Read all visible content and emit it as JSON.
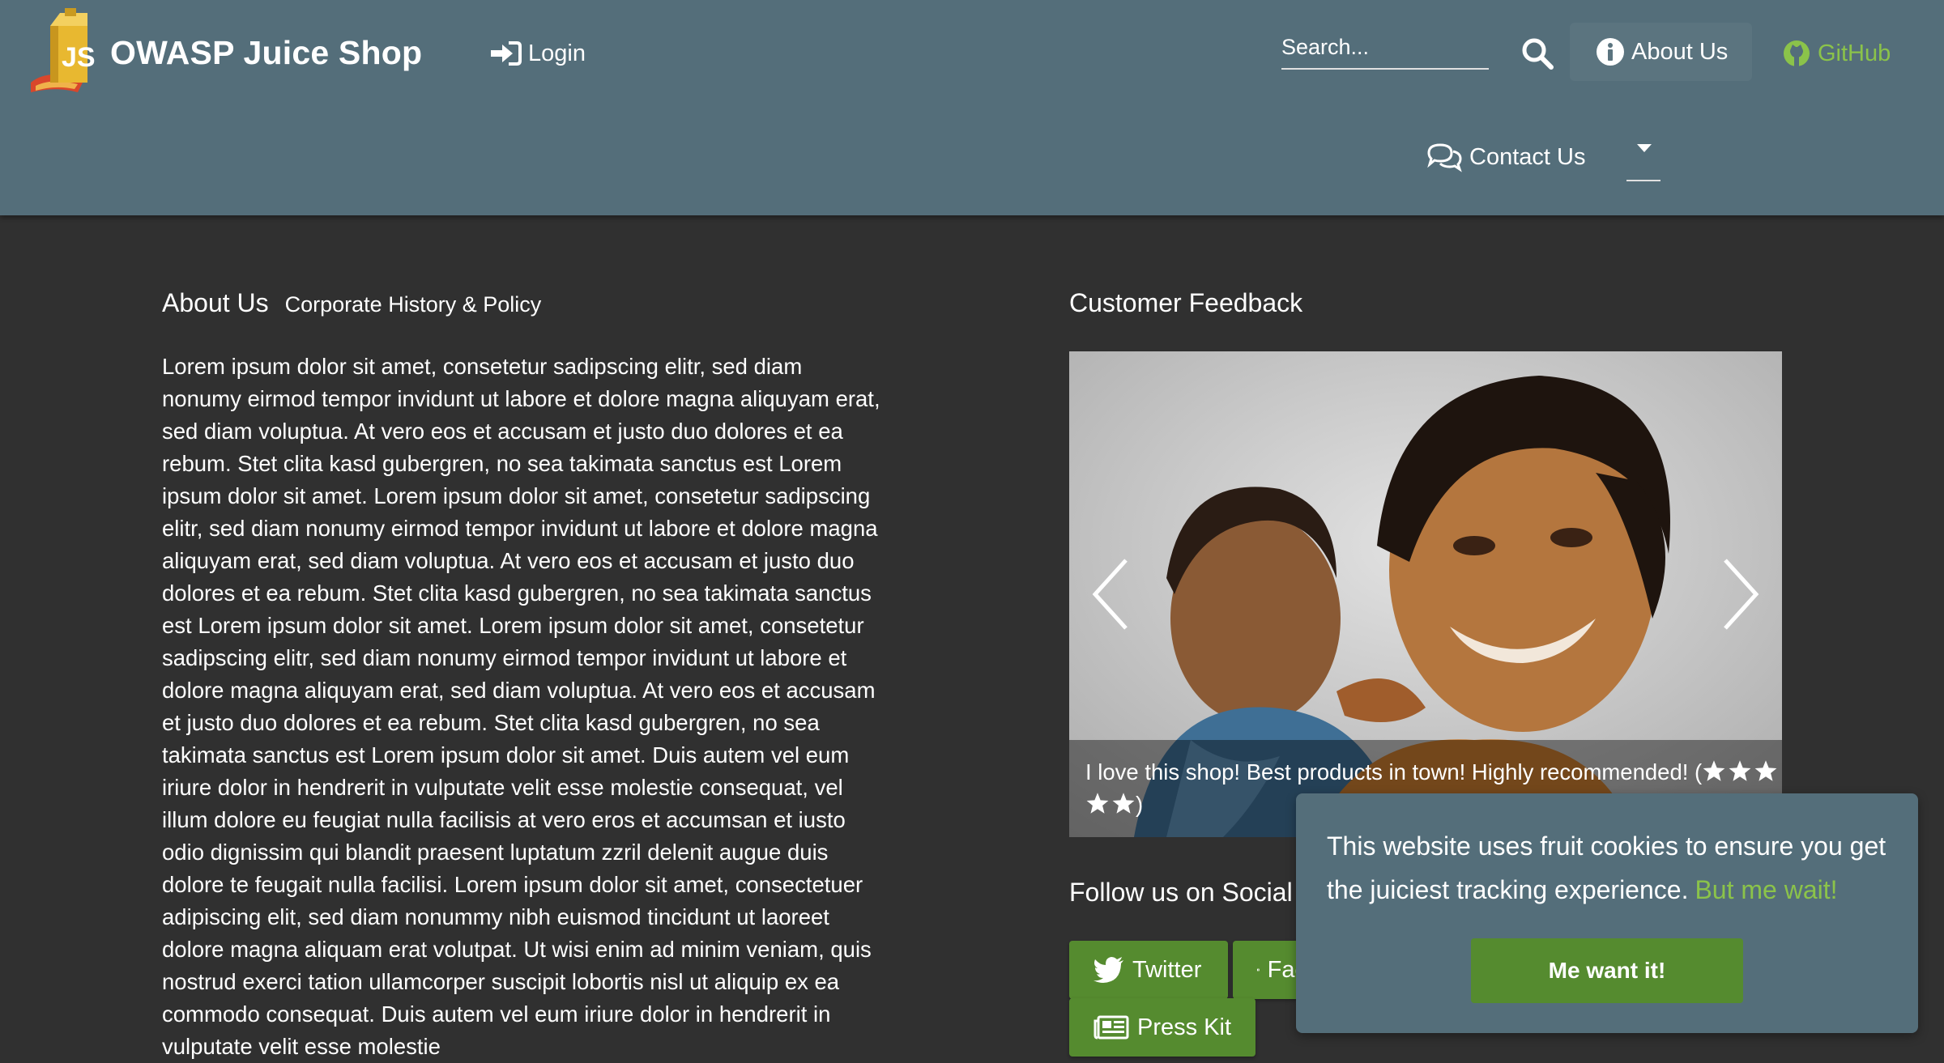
{
  "header": {
    "brand_title": "OWASP Juice Shop",
    "login_label": "Login",
    "search_placeholder": "Search...",
    "about_label": "About Us",
    "github_label": "GitHub",
    "contact_label": "Contact Us"
  },
  "about": {
    "title": "About Us",
    "subtitle": "Corporate History & Policy",
    "text": "Lorem ipsum dolor sit amet, consetetur sadipscing elitr, sed diam nonumy eirmod tempor invidunt ut labore et dolore magna aliquyam erat, sed diam voluptua. At vero eos et accusam et justo duo dolores et ea rebum. Stet clita kasd gubergren, no sea takimata sanctus est Lorem ipsum dolor sit amet. Lorem ipsum dolor sit amet, consetetur sadipscing elitr, sed diam nonumy eirmod tempor invidunt ut labore et dolore magna aliquyam erat, sed diam voluptua. At vero eos et accusam et justo duo dolores et ea rebum. Stet clita kasd gubergren, no sea takimata sanctus est Lorem ipsum dolor sit amet. Lorem ipsum dolor sit amet, consetetur sadipscing elitr, sed diam nonumy eirmod tempor invidunt ut labore et dolore magna aliquyam erat, sed diam voluptua. At vero eos et accusam et justo duo dolores et ea rebum. Stet clita kasd gubergren, no sea takimata sanctus est Lorem ipsum dolor sit amet. Duis autem vel eum iriure dolor in hendrerit in vulputate velit esse molestie consequat, vel illum dolore eu feugiat nulla facilisis at vero eros et accumsan et iusto odio dignissim qui blandit praesent luptatum zzril delenit augue duis dolore te feugait nulla facilisi. Lorem ipsum dolor sit amet, consectetuer adipiscing elit, sed diam nonummy nibh euismod tincidunt ut laoreet dolore magna aliquam erat volutpat. Ut wisi enim ad minim veniam, quis nostrud exerci tation ullamcorper suscipit lobortis nisl ut aliquip ex ea commodo consequat. Duis autem vel eum iriure dolor in hendrerit in vulputate velit esse molestie"
  },
  "feedback": {
    "title": "Customer Feedback",
    "caption": "I love this shop! Best products in town! Highly recommended! (",
    "caption_close": ")",
    "rating": 5
  },
  "social": {
    "title": "Follow us on Social",
    "twitter_label": "Twitter",
    "facebook_label": "Facebook",
    "presskit_label": "Press Kit"
  },
  "cookie": {
    "message": "This website uses fruit cookies to ensure you get the juiciest tracking experience.",
    "link_label": "But me wait!",
    "button_label": "Me want it!"
  },
  "colors": {
    "toolbar": "#546e7a",
    "background": "#303030",
    "accent_green": "#558b2f",
    "link_green": "#8bc34a"
  },
  "icons": [
    "juice-shop-logo",
    "sign-in-icon",
    "search-icon",
    "info-circle-icon",
    "github-icon",
    "comments-icon",
    "chevron-left-icon",
    "chevron-right-icon",
    "star-icon",
    "twitter-icon",
    "facebook-icon",
    "newspaper-icon"
  ]
}
